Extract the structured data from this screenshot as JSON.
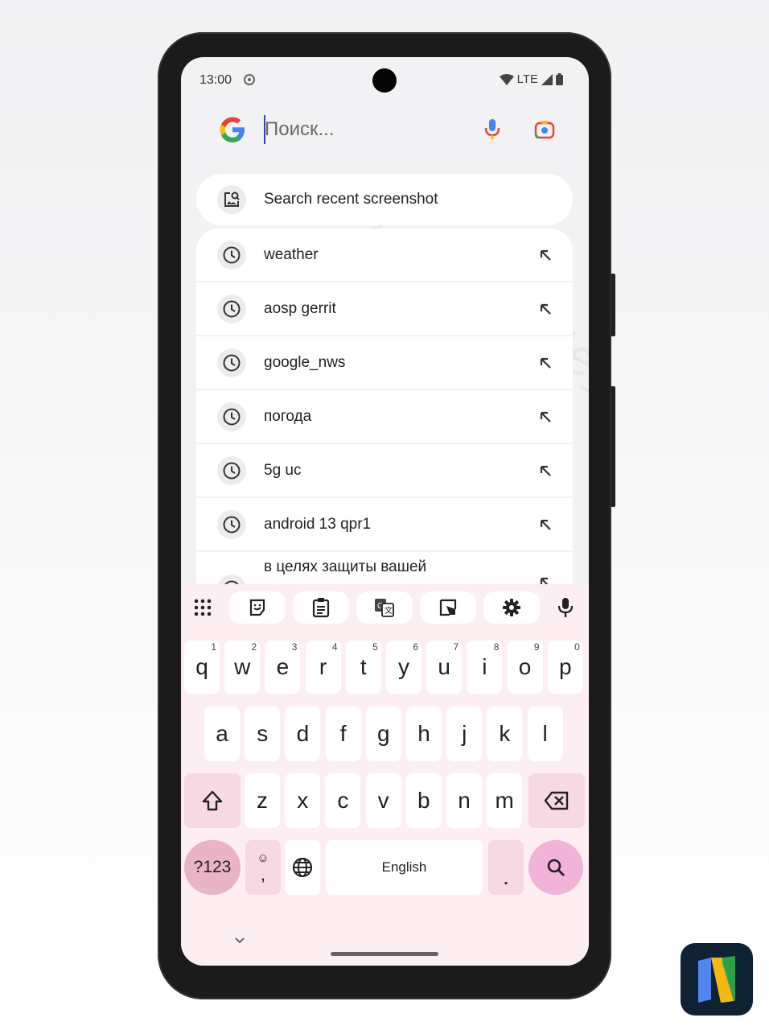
{
  "status_bar": {
    "time": "13:00",
    "network": "LTE",
    "icons": [
      "screen-record-icon",
      "wifi-icon",
      "signal-icon",
      "battery-icon"
    ]
  },
  "search": {
    "placeholder": "Поиск...",
    "value": "",
    "icons": [
      "google-logo",
      "microphone-icon",
      "lens-icon"
    ]
  },
  "screenshot_suggestion": {
    "label": "Search recent screenshot",
    "icon": "image-search-icon"
  },
  "history": [
    {
      "text": "weather"
    },
    {
      "text": "aosp gerrit"
    },
    {
      "text": "google_nws"
    },
    {
      "text": "погода"
    },
    {
      "text": "5g uc"
    },
    {
      "text": "android 13 qpr1"
    },
    {
      "text": "в целях защиты вашей"
    }
  ],
  "keyboard": {
    "toolbar": [
      "apps-grid-icon",
      "sticker-icon",
      "clipboard-icon",
      "translate-icon",
      "floating-keyboard-icon",
      "settings-icon",
      "microphone-icon"
    ],
    "row1": [
      {
        "key": "q",
        "hint": "1"
      },
      {
        "key": "w",
        "hint": "2"
      },
      {
        "key": "e",
        "hint": "3"
      },
      {
        "key": "r",
        "hint": "4"
      },
      {
        "key": "t",
        "hint": "5"
      },
      {
        "key": "y",
        "hint": "6"
      },
      {
        "key": "u",
        "hint": "7"
      },
      {
        "key": "i",
        "hint": "8"
      },
      {
        "key": "o",
        "hint": "9"
      },
      {
        "key": "p",
        "hint": "0"
      }
    ],
    "row2": [
      "a",
      "s",
      "d",
      "f",
      "g",
      "h",
      "j",
      "k",
      "l"
    ],
    "row3": [
      "z",
      "x",
      "c",
      "v",
      "b",
      "n",
      "m"
    ],
    "symbols_label": "?123",
    "emoji_comma_label": ",",
    "space_label": "English",
    "period_label": "."
  },
  "watermark": "t.me/google_nws",
  "colors": {
    "keyboard_bg": "#fdeef2",
    "function_key": "#f6d9e2",
    "symbols_key": "#e8b4c6",
    "action_key": "#f1b3d8"
  }
}
